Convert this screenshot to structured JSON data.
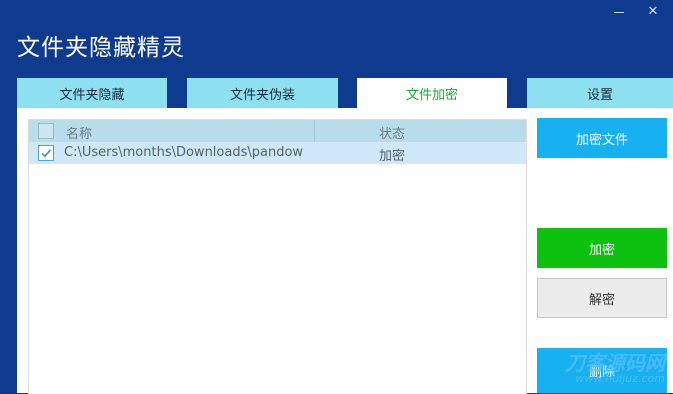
{
  "app": {
    "title": "文件夹隐藏精灵"
  },
  "tabs": [
    {
      "label": "文件夹隐藏",
      "active": false
    },
    {
      "label": "文件夹伪装",
      "active": false
    },
    {
      "label": "文件加密",
      "active": true
    },
    {
      "label": "设置",
      "active": false
    }
  ],
  "file_list": {
    "columns": [
      "名称",
      "状态"
    ],
    "rows": [
      {
        "checked": true,
        "path": "C:\\Users\\months\\Downloads\\pandow",
        "status": "加密"
      }
    ]
  },
  "actions": {
    "encrypt_file": "加密文件",
    "encrypt": "加密",
    "decrypt": "解密",
    "delete": "删除"
  },
  "watermark": {
    "line1": "刀客源码网",
    "line2": "www.huijuz.com"
  },
  "colors": {
    "window_bg": "#0f3b8f",
    "tab_inactive": "#8de0f0",
    "tab_active_text": "#20a63a",
    "button_blue": "#17b0f0",
    "button_green": "#0fc10f"
  }
}
